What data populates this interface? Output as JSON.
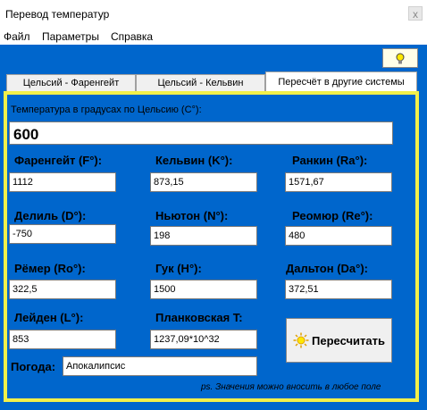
{
  "window": {
    "title": "Перевод температур",
    "close_glyph": "x"
  },
  "menu": {
    "file": "Файл",
    "params": "Параметры",
    "help": "Справка"
  },
  "tabs": [
    "Цельсий - Фаренгейт",
    "Цельсий - Кельвин",
    "Пересчёт в другие системы"
  ],
  "celsius": {
    "label": "Температура в градусах по Цельсию (C°):",
    "value": "600"
  },
  "scales": {
    "fahrenheit": {
      "label": "Фаренгейт (F°):",
      "value": "1112"
    },
    "kelvin": {
      "label": "Кельвин (K°):",
      "value": "873,15"
    },
    "rankine": {
      "label": "Ранкин (Ra°):",
      "value": "1571,67"
    },
    "delisle": {
      "label": "Делиль (D°):",
      "value": "-750"
    },
    "newton": {
      "label": "Ньютон (N°):",
      "value": "198"
    },
    "reaumur": {
      "label": "Реомюр (Re°):",
      "value": "480"
    },
    "romer": {
      "label": "Рёмер (Ro°):",
      "value": "322,5"
    },
    "hooke": {
      "label": "Гук (H°):",
      "value": "1500"
    },
    "dalton": {
      "label": "Дальтон (Da°):",
      "value": "372,51"
    },
    "leiden": {
      "label": "Лейден (L°):",
      "value": "853"
    },
    "planck": {
      "label": "Планковская T:",
      "value": "1237,09*10^32"
    }
  },
  "weather": {
    "label": "Погода:",
    "value": "Апокалипсис"
  },
  "recalc_button": "Пересчитать",
  "note": "ps. Значения можно вносить в любое поле",
  "colors": {
    "background": "#0066cc",
    "panel_border": "#f2f04a"
  }
}
